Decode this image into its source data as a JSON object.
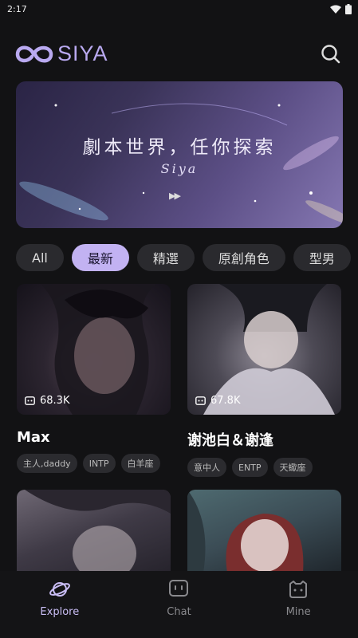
{
  "status_bar": {
    "time": "2:17"
  },
  "header": {
    "logo_text": "SIYA"
  },
  "banner": {
    "title": "劇本世界，任你探索",
    "script": "Siya",
    "arrow": "▶▶"
  },
  "tabs": [
    {
      "label": "All",
      "active": false
    },
    {
      "label": "最新",
      "active": true
    },
    {
      "label": "精選",
      "active": false
    },
    {
      "label": "原創角色",
      "active": false
    },
    {
      "label": "型男",
      "active": false
    }
  ],
  "cards": [
    {
      "name": "Max",
      "count": "68.3K",
      "tags": [
        "主人,daddy",
        "INTP",
        "白羊座"
      ]
    },
    {
      "name": "谢池白＆谢逢",
      "count": "67.8K",
      "tags": [
        "意中人",
        "ENTP",
        "天蠍座"
      ]
    }
  ],
  "nav": [
    {
      "label": "Explore",
      "active": true
    },
    {
      "label": "Chat",
      "active": false
    },
    {
      "label": "Mine",
      "active": false
    }
  ],
  "colors": {
    "accent": "#c2b2f2",
    "background": "#121214"
  }
}
